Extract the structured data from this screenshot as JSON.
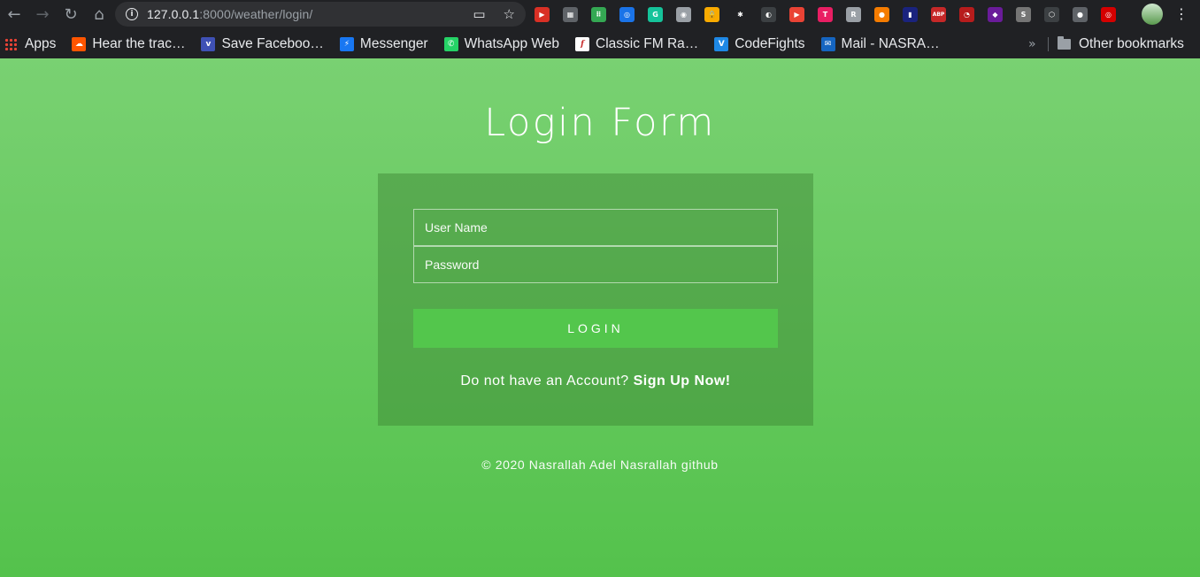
{
  "browser": {
    "nav": {
      "back_icon": "←",
      "forward_icon": "→",
      "reload_icon": "↻",
      "home_icon": "⌂"
    },
    "omnibox": {
      "host": "127.0.0.1",
      "path": ":8000/weather/login/",
      "info_icon": "i",
      "cast_icon": "▭",
      "star_icon": "☆"
    },
    "extensions": [
      {
        "name": "ext-red-play",
        "glyph": "▶",
        "color": "#d93025"
      },
      {
        "name": "ext-grey-puzzle",
        "glyph": "▦",
        "color": "#5f6368"
      },
      {
        "name": "ext-green-dots",
        "glyph": "⠿",
        "color": "#34a853"
      },
      {
        "name": "ext-compass",
        "glyph": "◎",
        "color": "#1a73e8"
      },
      {
        "name": "ext-grammarly",
        "glyph": "G",
        "color": "#15c39a"
      },
      {
        "name": "ext-camera",
        "glyph": "◉",
        "color": "#9aa0a6"
      },
      {
        "name": "ext-lock",
        "glyph": "🔒",
        "color": "#f9ab00"
      },
      {
        "name": "ext-paw",
        "glyph": "✱",
        "color": "#202124"
      },
      {
        "name": "ext-contrast",
        "glyph": "◐",
        "color": "#3c4043"
      },
      {
        "name": "ext-youtube",
        "glyph": "▶",
        "color": "#ea4335"
      },
      {
        "name": "ext-pink",
        "glyph": "T",
        "color": "#e91e63"
      },
      {
        "name": "ext-r",
        "glyph": "R",
        "color": "#9aa0a6"
      },
      {
        "name": "ext-orange",
        "glyph": "●",
        "color": "#f57c00"
      },
      {
        "name": "ext-bars",
        "glyph": "▮",
        "color": "#1a237e"
      },
      {
        "name": "ext-abp",
        "glyph": "ABP",
        "color": "#c62828"
      },
      {
        "name": "ext-red-circle",
        "glyph": "◔",
        "color": "#b71c1c"
      },
      {
        "name": "ext-purple",
        "glyph": "◆",
        "color": "#6a1b9a"
      },
      {
        "name": "ext-s",
        "glyph": "S",
        "color": "#757575"
      },
      {
        "name": "ext-hex",
        "glyph": "⬡",
        "color": "#3c4043"
      },
      {
        "name": "ext-white-dot",
        "glyph": "●",
        "color": "#5f6368"
      },
      {
        "name": "ext-red-ring",
        "glyph": "◎",
        "color": "#d50000"
      }
    ],
    "menu_icon": "⋮"
  },
  "bookmarks": {
    "items": [
      {
        "label": "Apps",
        "icon": "apps-grid-icon",
        "color": "#ea4335",
        "glyph": ""
      },
      {
        "label": "Hear the trac…",
        "icon": "soundcloud-icon",
        "color": "#ff5500",
        "glyph": "☁"
      },
      {
        "label": "Save Faceboo…",
        "icon": "save-facebook-icon",
        "color": "#3f51b5",
        "glyph": "v"
      },
      {
        "label": "Messenger",
        "icon": "messenger-icon",
        "color": "#1877f2",
        "glyph": "⚡"
      },
      {
        "label": "WhatsApp Web",
        "icon": "whatsapp-icon",
        "color": "#25d366",
        "glyph": "✆"
      },
      {
        "label": "Classic FM Ra…",
        "icon": "classic-fm-icon",
        "color": "#ffffff",
        "glyph": "f"
      },
      {
        "label": "CodeFights",
        "icon": "codefights-icon",
        "color": "#1e88e5",
        "glyph": "V"
      },
      {
        "label": "Mail - NASRA…",
        "icon": "mail-icon",
        "color": "#1565c0",
        "glyph": "✉"
      }
    ],
    "more_icon": "»",
    "other_label": "Other bookmarks"
  },
  "page": {
    "title": "Login Form",
    "username_placeholder": "User Name",
    "password_placeholder": "Password",
    "login_label": "LOGIN",
    "signup_prompt": "Do not have an Account?",
    "signup_link": "Sign Up Now!",
    "footer": "© 2020 Nasrallah Adel Nasrallah github"
  }
}
